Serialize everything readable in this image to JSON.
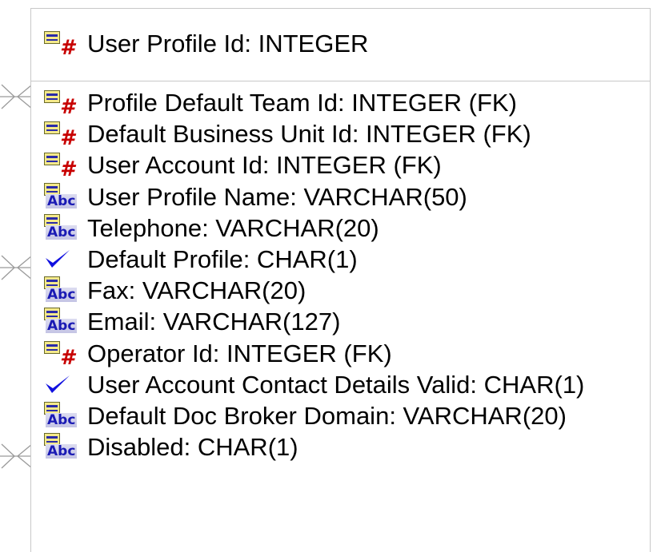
{
  "entity": {
    "primary_key": [
      {
        "icon": "numeric",
        "text": "User Profile Id: INTEGER"
      }
    ],
    "attributes": [
      {
        "icon": "numeric",
        "text": "Profile Default Team Id: INTEGER (FK)"
      },
      {
        "icon": "numeric",
        "text": "Default Business Unit Id: INTEGER (FK)"
      },
      {
        "icon": "numeric",
        "text": "User Account Id: INTEGER (FK)"
      },
      {
        "icon": "text",
        "text": "User Profile Name: VARCHAR(50)"
      },
      {
        "icon": "text",
        "text": "Telephone: VARCHAR(20)"
      },
      {
        "icon": "check",
        "text": "Default Profile: CHAR(1)"
      },
      {
        "icon": "text",
        "text": "Fax: VARCHAR(20)"
      },
      {
        "icon": "text",
        "text": "Email: VARCHAR(127)"
      },
      {
        "icon": "numeric",
        "text": "Operator Id: INTEGER (FK)"
      },
      {
        "icon": "check",
        "text": "User Account Contact Details Valid: CHAR(1)"
      },
      {
        "icon": "text",
        "text": "Default Doc Broker Domain: VARCHAR(20)"
      },
      {
        "icon": "text",
        "text": "Disabled: CHAR(1)"
      }
    ]
  },
  "icons": {
    "numeric": "numeric-column-icon",
    "text": "text-column-icon",
    "check": "boolean-check-icon",
    "connector": "crows-foot-connector"
  },
  "colors": {
    "border": "#c8c8c8",
    "hash": "#c80000",
    "check": "#1010e0",
    "abc": "#1a1ab4",
    "table_icon": "#f4e98a"
  }
}
